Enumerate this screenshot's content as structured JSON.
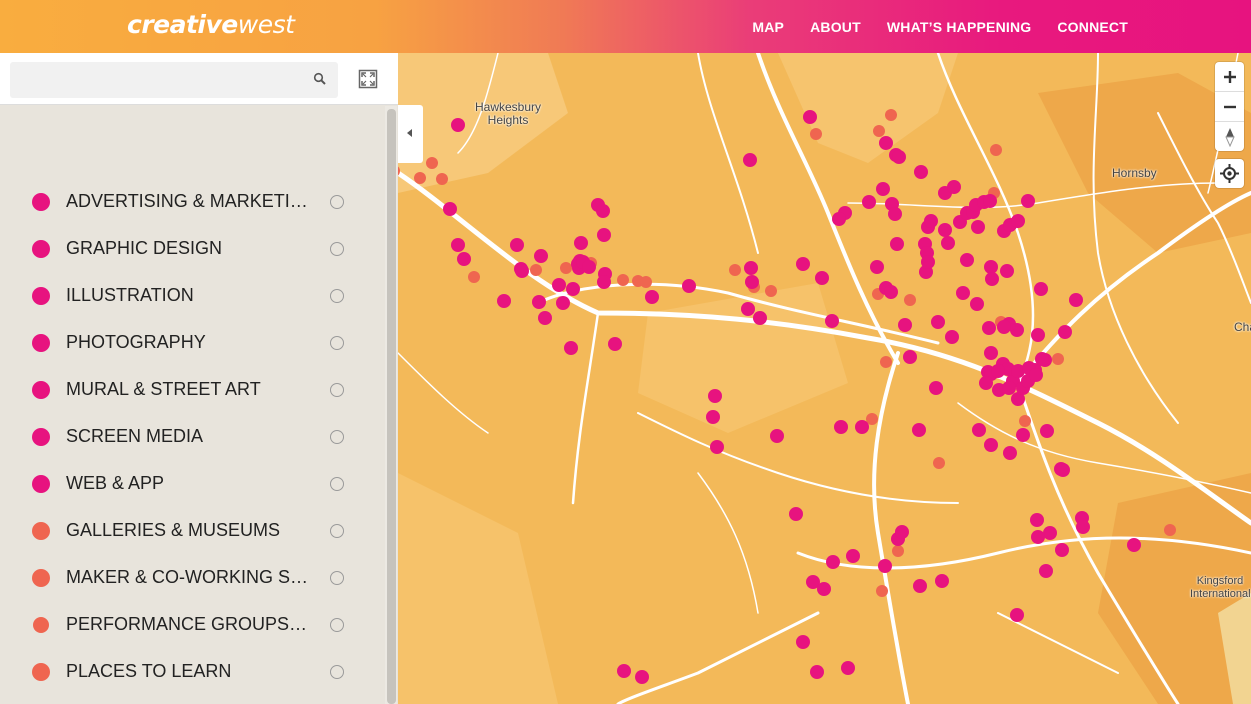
{
  "header": {
    "logo_bold": "creative",
    "logo_thin": "west",
    "nav": [
      {
        "label": "MAP"
      },
      {
        "label": "ABOUT"
      },
      {
        "label": "WHAT’S HAPPENING"
      },
      {
        "label": "CONNECT"
      }
    ]
  },
  "search": {
    "placeholder": "",
    "value": ""
  },
  "icons": {
    "search": "search-icon",
    "fullscreen": "fullscreen-icon",
    "collapse": "chevron-left-icon",
    "zoom_in": "plus-icon",
    "zoom_out": "minus-icon",
    "compass": "compass-icon",
    "geolocate": "crosshair-icon"
  },
  "colors": {
    "primary": "#e7137f",
    "secondary": "#ef6550",
    "map_land": "#f3b959",
    "road": "#ffffff"
  },
  "categories": [
    {
      "label": "ADVERTISING & MARKETING",
      "color": "#e7137f"
    },
    {
      "label": "GRAPHIC DESIGN",
      "color": "#e7137f"
    },
    {
      "label": "ILLUSTRATION",
      "color": "#e7137f"
    },
    {
      "label": "PHOTOGRAPHY",
      "color": "#e7137f"
    },
    {
      "label": "MURAL & STREET ART",
      "color": "#e7137f"
    },
    {
      "label": "SCREEN MEDIA",
      "color": "#e7137f"
    },
    {
      "label": "WEB & APP",
      "color": "#e7137f"
    },
    {
      "label": "GALLERIES & MUSEUMS",
      "color": "#ef6550"
    },
    {
      "label": "MAKER & CO-WORKING SPA...",
      "color": "#ef6550"
    },
    {
      "label": "PERFORMANCE GROUPS & ...",
      "color": "#ef6550"
    },
    {
      "label": "PLACES TO LEARN",
      "color": "#ef6550"
    }
  ],
  "map": {
    "labels": [
      {
        "text": "Hawkesbury Heights"
      },
      {
        "text": "Hornsby"
      },
      {
        "text": "Chats"
      },
      {
        "text": "Kingsford International"
      }
    ],
    "markers": {
      "pink": [
        [
          60,
          72
        ],
        [
          52,
          156
        ],
        [
          60,
          192
        ],
        [
          66,
          206
        ],
        [
          106,
          248
        ],
        [
          123,
          216
        ],
        [
          119,
          192
        ],
        [
          124,
          218
        ],
        [
          143,
          203
        ],
        [
          141,
          249
        ],
        [
          147,
          265
        ],
        [
          173,
          295
        ],
        [
          181,
          215
        ],
        [
          183,
          190
        ],
        [
          200,
          152
        ],
        [
          205,
          158
        ],
        [
          206,
          182
        ],
        [
          182,
          208
        ],
        [
          180,
          211
        ],
        [
          185,
          209
        ],
        [
          191,
          214
        ],
        [
          207,
          221
        ],
        [
          206,
          229
        ],
        [
          161,
          232
        ],
        [
          165,
          250
        ],
        [
          175,
          236
        ],
        [
          254,
          244
        ],
        [
          291,
          233
        ],
        [
          352,
          107
        ],
        [
          412,
          64
        ],
        [
          488,
          90
        ],
        [
          498,
          102
        ],
        [
          501,
          104
        ],
        [
          523,
          119
        ],
        [
          547,
          140
        ],
        [
          556,
          134
        ],
        [
          485,
          136
        ],
        [
          471,
          149
        ],
        [
          494,
          151
        ],
        [
          497,
          161
        ],
        [
          447,
          160
        ],
        [
          441,
          166
        ],
        [
          353,
          215
        ],
        [
          405,
          211
        ],
        [
          424,
          225
        ],
        [
          479,
          214
        ],
        [
          488,
          235
        ],
        [
          493,
          239
        ],
        [
          499,
          191
        ],
        [
          527,
          191
        ],
        [
          529,
          200
        ],
        [
          528,
          219
        ],
        [
          530,
          209
        ],
        [
          530,
          174
        ],
        [
          533,
          168
        ],
        [
          550,
          190
        ],
        [
          547,
          177
        ],
        [
          562,
          169
        ],
        [
          569,
          160
        ],
        [
          575,
          159
        ],
        [
          578,
          152
        ],
        [
          586,
          149
        ],
        [
          592,
          148
        ],
        [
          580,
          174
        ],
        [
          569,
          207
        ],
        [
          593,
          214
        ],
        [
          594,
          226
        ],
        [
          609,
          218
        ],
        [
          606,
          178
        ],
        [
          612,
          172
        ],
        [
          620,
          168
        ],
        [
          630,
          148
        ],
        [
          643,
          236
        ],
        [
          678,
          247
        ],
        [
          667,
          279
        ],
        [
          640,
          282
        ],
        [
          619,
          277
        ],
        [
          611,
          271
        ],
        [
          591,
          275
        ],
        [
          606,
          274
        ],
        [
          593,
          300
        ],
        [
          590,
          319
        ],
        [
          579,
          251
        ],
        [
          565,
          240
        ],
        [
          554,
          284
        ],
        [
          540,
          269
        ],
        [
          512,
          304
        ],
        [
          507,
          272
        ],
        [
          434,
          268
        ],
        [
          350,
          256
        ],
        [
          362,
          265
        ],
        [
          354,
          229
        ],
        [
          319,
          394
        ],
        [
          379,
          383
        ],
        [
          398,
          461
        ],
        [
          443,
          374
        ],
        [
          464,
          374
        ],
        [
          521,
          377
        ],
        [
          581,
          377
        ],
        [
          593,
          392
        ],
        [
          612,
          400
        ],
        [
          625,
          382
        ],
        [
          649,
          378
        ],
        [
          663,
          416
        ],
        [
          665,
          417
        ],
        [
          639,
          467
        ],
        [
          652,
          480
        ],
        [
          640,
          484
        ],
        [
          664,
          497
        ],
        [
          684,
          465
        ],
        [
          685,
          474
        ],
        [
          736,
          492
        ],
        [
          648,
          518
        ],
        [
          593,
          321
        ],
        [
          605,
          311
        ],
        [
          615,
          328
        ],
        [
          620,
          346
        ],
        [
          625,
          335
        ],
        [
          630,
          328
        ],
        [
          637,
          317
        ],
        [
          647,
          307
        ],
        [
          610,
          316
        ],
        [
          620,
          318
        ],
        [
          631,
          315
        ],
        [
          638,
          322
        ],
        [
          600,
          318
        ],
        [
          644,
          306
        ],
        [
          601,
          337
        ],
        [
          611,
          335
        ],
        [
          588,
          330
        ],
        [
          538,
          335
        ],
        [
          500,
          486
        ],
        [
          504,
          479
        ],
        [
          487,
          513
        ],
        [
          522,
          533
        ],
        [
          544,
          528
        ],
        [
          435,
          509
        ],
        [
          415,
          529
        ],
        [
          426,
          536
        ],
        [
          455,
          503
        ],
        [
          405,
          589
        ],
        [
          419,
          619
        ],
        [
          450,
          615
        ],
        [
          226,
          618
        ],
        [
          244,
          624
        ],
        [
          619,
          562
        ],
        [
          217,
          291
        ],
        [
          315,
          364
        ],
        [
          317,
          343
        ]
      ],
      "orange": [
        [
          -4,
          118
        ],
        [
          22,
          125
        ],
        [
          34,
          110
        ],
        [
          44,
          126
        ],
        [
          76,
          224
        ],
        [
          138,
          217
        ],
        [
          168,
          215
        ],
        [
          193,
          210
        ],
        [
          225,
          227
        ],
        [
          240,
          228
        ],
        [
          248,
          229
        ],
        [
          337,
          217
        ],
        [
          356,
          234
        ],
        [
          373,
          238
        ],
        [
          418,
          81
        ],
        [
          481,
          78
        ],
        [
          493,
          62
        ],
        [
          598,
          97
        ],
        [
          596,
          140
        ],
        [
          512,
          247
        ],
        [
          480,
          241
        ],
        [
          603,
          269
        ],
        [
          627,
          368
        ],
        [
          541,
          410
        ],
        [
          474,
          366
        ],
        [
          500,
          498
        ],
        [
          484,
          538
        ],
        [
          660,
          306
        ],
        [
          772,
          477
        ],
        [
          488,
          309
        ]
      ]
    }
  }
}
